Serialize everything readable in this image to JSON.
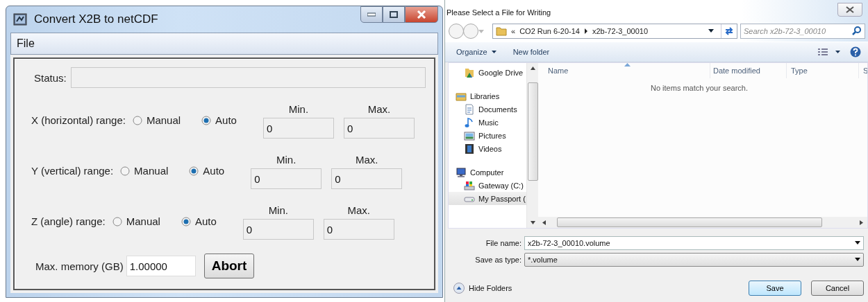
{
  "converter_window": {
    "title": "Convert X2B to netCDF",
    "menu": [
      "File"
    ],
    "status": {
      "label": "Status:"
    },
    "ranges": [
      {
        "label": "X (horizontal) range:",
        "options": [
          {
            "label": "Manual",
            "selected": false
          },
          {
            "label": "Auto",
            "selected": true
          }
        ],
        "min_label": "Min.",
        "min_value": "0",
        "max_label": "Max.",
        "max_value": "0"
      },
      {
        "label": "Y (vertical) range:",
        "options": [
          {
            "label": "Manual",
            "selected": false
          },
          {
            "label": "Auto",
            "selected": true
          }
        ],
        "min_label": "Min.",
        "min_value": "0",
        "max_label": "Max.",
        "max_value": "0"
      },
      {
        "label": "Z (angle) range:",
        "options": [
          {
            "label": "Manual",
            "selected": false
          },
          {
            "label": "Auto",
            "selected": true
          }
        ],
        "min_label": "Min.",
        "min_value": "0",
        "max_label": "Max.",
        "max_value": "0"
      }
    ],
    "memory": {
      "label": "Max. memory (GB)",
      "value": "1.00000"
    },
    "abort_button": "Abort"
  },
  "save_dialog": {
    "title": "Please Select a File for Writing",
    "address": {
      "overflow_mark": "«",
      "crumbs": [
        "CO2 Run 6-20-14",
        "x2b-72-3_00010"
      ]
    },
    "search": {
      "placeholder": "Search x2b-72-3_00010"
    },
    "toolbar": [
      {
        "label": "Organize",
        "kind": "menu"
      },
      {
        "label": "New folder",
        "kind": "button"
      }
    ],
    "nav": [
      {
        "label": "Google Drive",
        "kind": "cloud",
        "selected": false
      },
      {
        "label": "Libraries",
        "kind": "library",
        "selected": false,
        "children": [
          {
            "label": "Documents",
            "kind": "document",
            "selected": false
          },
          {
            "label": "Music",
            "kind": "music",
            "selected": false
          },
          {
            "label": "Pictures",
            "kind": "picture",
            "selected": false
          },
          {
            "label": "Videos",
            "kind": "video",
            "selected": false
          }
        ]
      },
      {
        "label": "Computer",
        "kind": "computer",
        "selected": false,
        "children": [
          {
            "label": "Gateway (C:)",
            "kind": "system-drive",
            "selected": false
          },
          {
            "label": "My Passport (",
            "kind": "drive",
            "selected": true
          }
        ]
      }
    ],
    "columns": [
      "Name",
      "Date modified",
      "Type",
      "S"
    ],
    "empty_message": "No items match your search.",
    "file_name": {
      "label": "File name:",
      "value": "x2b-72-3_00010.volume"
    },
    "save_type": {
      "label": "Save as type:",
      "value": "*.volume"
    },
    "hide_folders": "Hide Folders",
    "buttons": [
      {
        "label": "Save",
        "default": true
      },
      {
        "label": "Cancel",
        "default": false
      }
    ]
  }
}
